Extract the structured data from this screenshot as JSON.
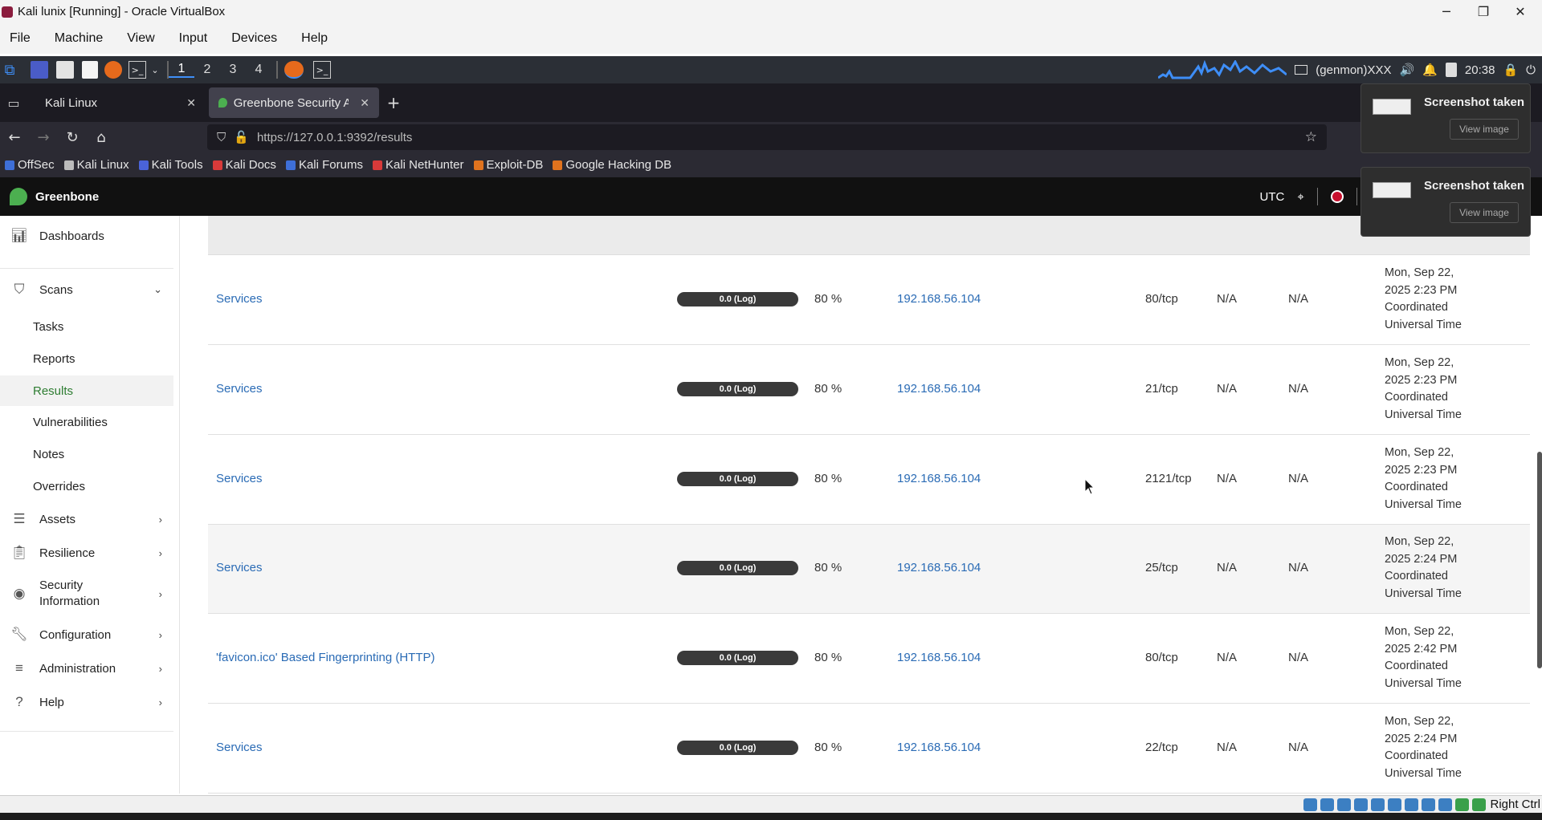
{
  "vbox": {
    "title": "Kali lunix [Running] - Oracle VirtualBox",
    "menu": [
      "File",
      "Machine",
      "View",
      "Input",
      "Devices",
      "Help"
    ],
    "host_key": "Right Ctrl"
  },
  "kali_panel": {
    "workspaces": [
      "1",
      "2",
      "3",
      "4"
    ],
    "genmon": "(genmon)XXX",
    "clock": "20:38"
  },
  "browser": {
    "tabs": [
      {
        "label": "Kali Linux"
      },
      {
        "label": "Greenbone Security Assis"
      }
    ],
    "url": "https://127.0.0.1:9392/results",
    "bookmarks": [
      "OffSec",
      "Kali Linux",
      "Kali Tools",
      "Kali Docs",
      "Kali Forums",
      "Kali NetHunter",
      "Exploit-DB",
      "Google Hacking DB"
    ]
  },
  "gsa": {
    "brand": "Greenbone",
    "timezone": "UTC"
  },
  "sidebar": {
    "dashboards": "Dashboards",
    "scans": "Scans",
    "scans_sub": [
      "Tasks",
      "Reports",
      "Results",
      "Vulnerabilities",
      "Notes",
      "Overrides"
    ],
    "assets": "Assets",
    "resilience": "Resilience",
    "security_info": [
      "Security",
      "Information"
    ],
    "configuration": "Configuration",
    "administration": "Administration",
    "help": "Help"
  },
  "results": [
    {
      "name": "Services",
      "severity": "0.0 (Log)",
      "qod": "80 %",
      "host": "192.168.56.104",
      "port": "80/tcp",
      "na1": "N/A",
      "na2": "N/A",
      "created": [
        "Mon, Sep 22,",
        "2025 2:23 PM",
        "Coordinated",
        "Universal Time"
      ]
    },
    {
      "name": "Services",
      "severity": "0.0 (Log)",
      "qod": "80 %",
      "host": "192.168.56.104",
      "port": "21/tcp",
      "na1": "N/A",
      "na2": "N/A",
      "created": [
        "Mon, Sep 22,",
        "2025 2:23 PM",
        "Coordinated",
        "Universal Time"
      ]
    },
    {
      "name": "Services",
      "severity": "0.0 (Log)",
      "qod": "80 %",
      "host": "192.168.56.104",
      "port": "2121/tcp",
      "na1": "N/A",
      "na2": "N/A",
      "created": [
        "Mon, Sep 22,",
        "2025 2:23 PM",
        "Coordinated",
        "Universal Time"
      ]
    },
    {
      "name": "Services",
      "severity": "0.0 (Log)",
      "qod": "80 %",
      "host": "192.168.56.104",
      "port": "25/tcp",
      "na1": "N/A",
      "na2": "N/A",
      "created": [
        "Mon, Sep 22,",
        "2025 2:24 PM",
        "Coordinated",
        "Universal Time"
      ]
    },
    {
      "name": "'favicon.ico' Based Fingerprinting (HTTP)",
      "severity": "0.0 (Log)",
      "qod": "80 %",
      "host": "192.168.56.104",
      "port": "80/tcp",
      "na1": "N/A",
      "na2": "N/A",
      "created": [
        "Mon, Sep 22,",
        "2025 2:42 PM",
        "Coordinated",
        "Universal Time"
      ]
    },
    {
      "name": "Services",
      "severity": "0.0 (Log)",
      "qod": "80 %",
      "host": "192.168.56.104",
      "port": "22/tcp",
      "na1": "N/A",
      "na2": "N/A",
      "created": [
        "Mon, Sep 22,",
        "2025 2:24 PM",
        "Coordinated",
        "Universal Time"
      ]
    }
  ],
  "notifications": [
    {
      "title": "Screenshot taken",
      "action": "View image"
    },
    {
      "title": "Screenshot taken",
      "action": "View image"
    }
  ],
  "colors": {
    "link": "#2a6bb5",
    "active_nav": "#2e7d32",
    "severity_bar": "#3a3a3a"
  }
}
